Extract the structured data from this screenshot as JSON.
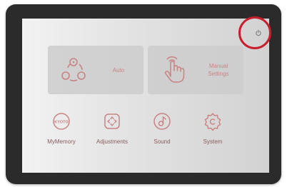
{
  "tiles": {
    "auto": {
      "label": "Auto",
      "icon": "auto-cycle-icon"
    },
    "manual": {
      "label": "Manual Settings",
      "icon": "hand-tap-icon"
    }
  },
  "nav": [
    {
      "label": "MyMemory",
      "icon": "my-memory-icon",
      "icon_text": "KYOTO"
    },
    {
      "label": "Adjustments",
      "icon": "adjustments-icon"
    },
    {
      "label": "Sound",
      "icon": "music-note-icon"
    },
    {
      "label": "System",
      "icon": "system-gear-icon"
    }
  ],
  "power": {
    "icon": "power-icon"
  },
  "colors": {
    "accent": "#c98383",
    "label": "#8a5b5b",
    "highlight_ring": "#c81f2e",
    "bezel": "#2b2b2b"
  }
}
